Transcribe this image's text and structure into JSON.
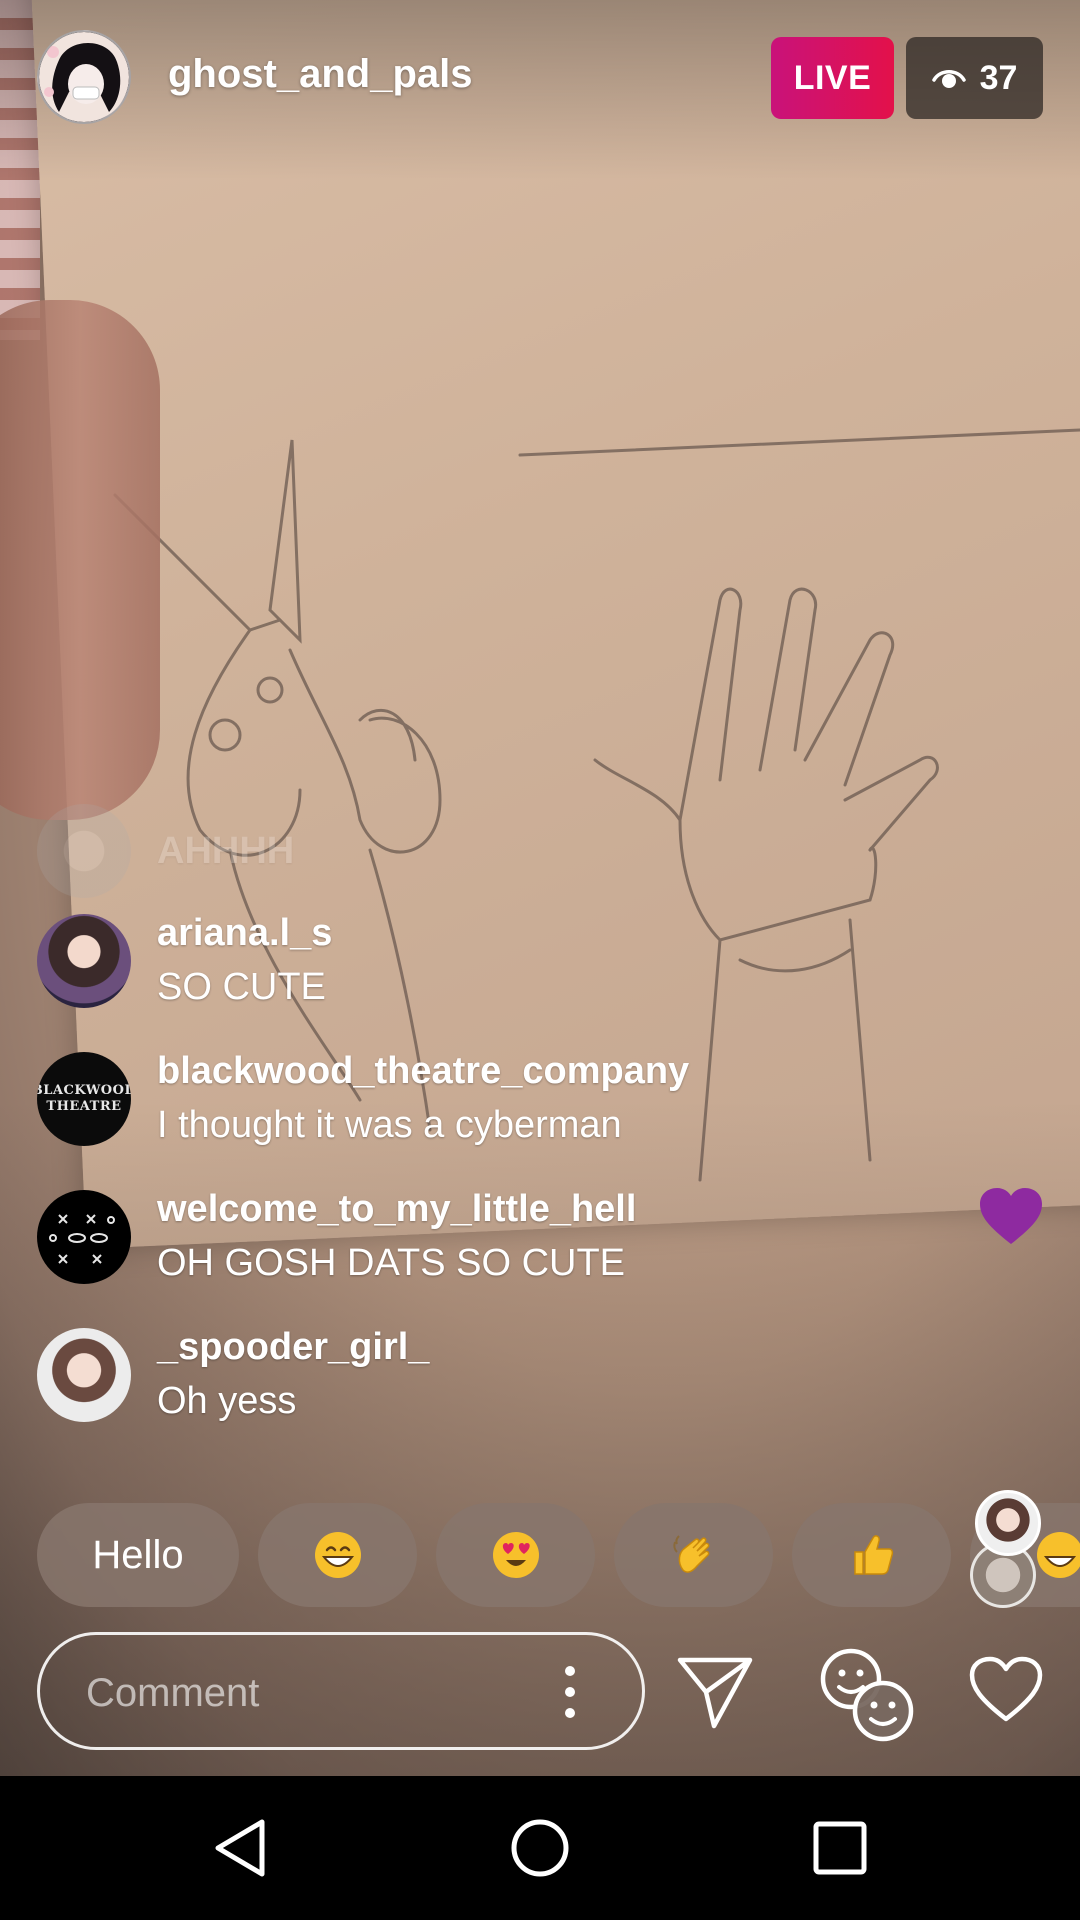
{
  "header": {
    "username": "ghost_and_pals",
    "live_label": "LIVE",
    "viewer_count": "37"
  },
  "comments": [
    {
      "user": "",
      "text": "AHHHH",
      "faded": true
    },
    {
      "user": "ariana.l_s",
      "text": "SO CUTE"
    },
    {
      "user": "blackwood_theatre_company",
      "text": "I thought it was a cyberman"
    },
    {
      "user": "welcome_to_my_little_hell",
      "text": "OH GOSH DATS SO CUTE",
      "liked": true
    },
    {
      "user": "_spooder_girl_",
      "text": "Oh yess"
    }
  ],
  "avatar_text": {
    "blackwood_line1": "BLACKWOOD",
    "blackwood_line2": "THEATRE"
  },
  "quick_reactions": {
    "hello_label": "Hello",
    "emojis": [
      "grinning-face-with-smiling-eyes",
      "smiling-face-with-heart-eyes",
      "waving-hand",
      "thumbs-up"
    ]
  },
  "comment_bar": {
    "placeholder": "Comment"
  },
  "icons": {
    "send": "paper-plane-icon",
    "activity": "two-faces-icon",
    "like": "heart-outline-icon"
  },
  "colors": {
    "live_gradient_start": "#c9127a",
    "live_gradient_end": "#e3114a",
    "like_heart": "#8e2aa0"
  }
}
